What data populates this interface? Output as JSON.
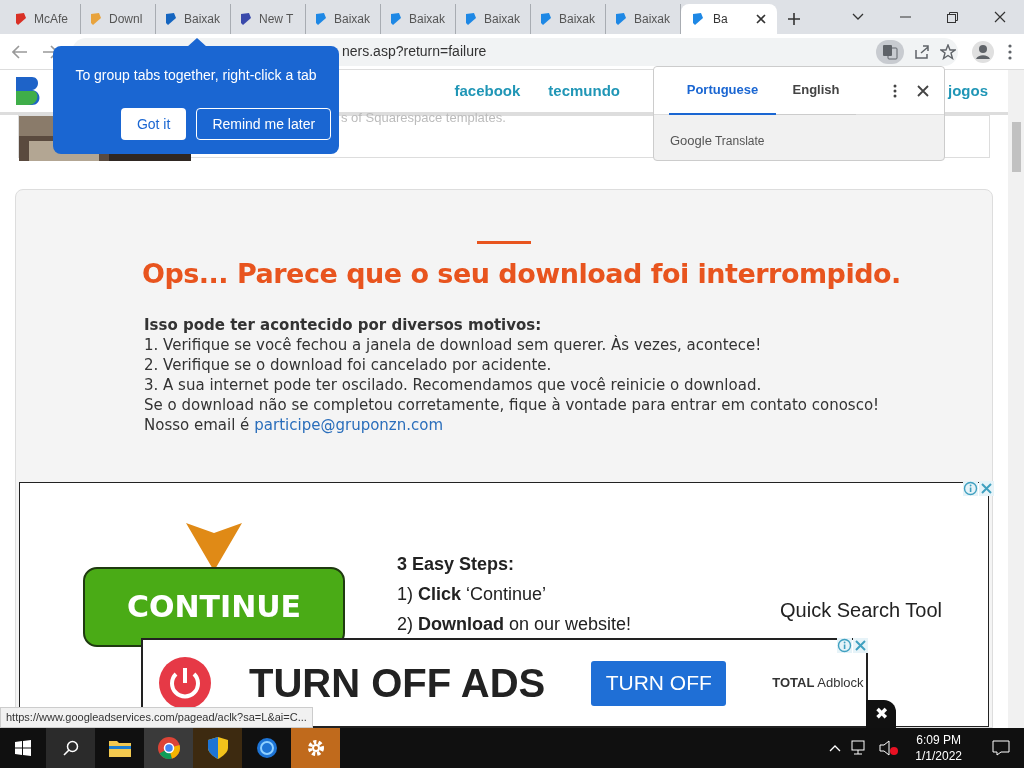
{
  "tabs": [
    {
      "label": "McAfe",
      "selected": false
    },
    {
      "label": "Downl",
      "selected": false
    },
    {
      "label": "Baixak",
      "selected": false
    },
    {
      "label": "New T",
      "selected": false
    },
    {
      "label": "Baixak",
      "selected": false
    },
    {
      "label": "Baixak",
      "selected": false
    },
    {
      "label": "Baixak",
      "selected": false
    },
    {
      "label": "Baixak",
      "selected": false
    },
    {
      "label": "Baixak",
      "selected": false
    },
    {
      "label": "Ba",
      "selected": true
    }
  ],
  "address": "ners.asp?return=failure",
  "translate_active": true,
  "tab_group_tip": {
    "text": "To group tabs together, right-click a tab",
    "buttons": [
      "Got it",
      "Remind me later"
    ]
  },
  "translate_popup": {
    "languages": [
      {
        "label": "Portuguese",
        "selected": true
      },
      {
        "label": "English",
        "selected": false
      }
    ],
    "brand": "Google",
    "product": "Translate"
  },
  "site_nav": [
    "facebook",
    "tecmundo",
    "jogos"
  ],
  "teaser": "s of Squarespace templates.",
  "error": {
    "title": "Ops... Parece que o seu download foi interrompido.",
    "intro": "Isso pode ter acontecido por diversos motivos:",
    "lines": [
      "1. Verifique se você fechou a janela de download sem querer. Às vezes, acontece!",
      "2. Verifique se o download foi cancelado por acidente.",
      "3. A sua internet pode ter oscilado. Recomendamos que você reinicie o download.",
      "Se o download não se completou corretamente, fique à vontade para entrar em contato conosco!"
    ],
    "email_prefix": "Nosso email é",
    "email": "participe@gruponzn.com"
  },
  "ad": {
    "button": "CONTINUE",
    "heading": "3 Easy Steps:",
    "steps": [
      "1) **Click** ‘Continue’",
      "2) **Download** on our website!"
    ],
    "product": "Quick Search Tool"
  },
  "ad2": {
    "headline": "TURN OFF ADS",
    "button": "TURN OFF",
    "brand_bold": "TOTAL",
    "brand": "Adblock",
    "close": "✖"
  },
  "status_url": "https://www.googleadservices.com/pagead/aclk?sa=L&ai=C...",
  "taskbar": {
    "time": "6:09 PM",
    "date": "1/1/2022"
  }
}
